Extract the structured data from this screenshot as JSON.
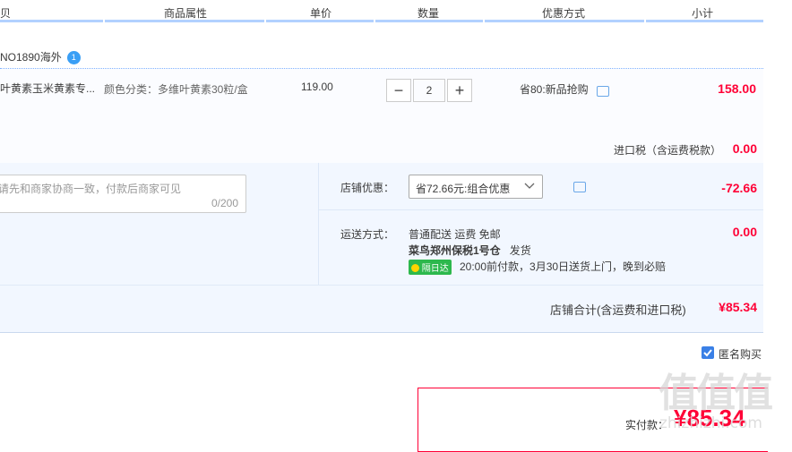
{
  "header": {
    "cols": [
      "贝",
      "商品属性",
      "单价",
      "数量",
      "优惠方式",
      "小计"
    ]
  },
  "shop": {
    "name": "NO1890海外",
    "badge": "1"
  },
  "item": {
    "title": "叶黄素玉米黄素专...",
    "attr": "颜色分类：多维叶黄素30粒/盒",
    "price": "119.00",
    "qty": "2",
    "qty_minus": "−",
    "qty_plus": "+",
    "promo": "省80:新品抢购",
    "subtotal": "158.00"
  },
  "tax": {
    "label": "进口税（含运费税款）",
    "value": "0.00"
  },
  "message": {
    "placeholder": "请先和商家协商一致，付款后商家可见",
    "counter": "0/200"
  },
  "shop_discount": {
    "label": "店铺优惠：",
    "selected": "省72.66元:组合优惠",
    "value": "-72.66"
  },
  "shipping": {
    "label": "运送方式：",
    "method": "普通配送 运费 免邮",
    "warehouse": "菜鸟郑州保税1号仓",
    "ship_word": "发货",
    "tag": "隔日达",
    "note": "20:00前付款，3月30日送货上门，晚到必赔",
    "value": "0.00"
  },
  "shop_total": {
    "label": "店铺合计(含运费和进口税)",
    "value": "¥85.34"
  },
  "anonymous": {
    "label": "匿名购买",
    "checked": true
  },
  "payment": {
    "label": "实付款：",
    "value": "¥85.34"
  },
  "watermark": {
    "text": "值值值",
    "url": "zhizhizhi.com"
  },
  "colors": {
    "accent": "#ff0036",
    "blue": "#3a80e6",
    "tag_green": "#2db84d"
  }
}
